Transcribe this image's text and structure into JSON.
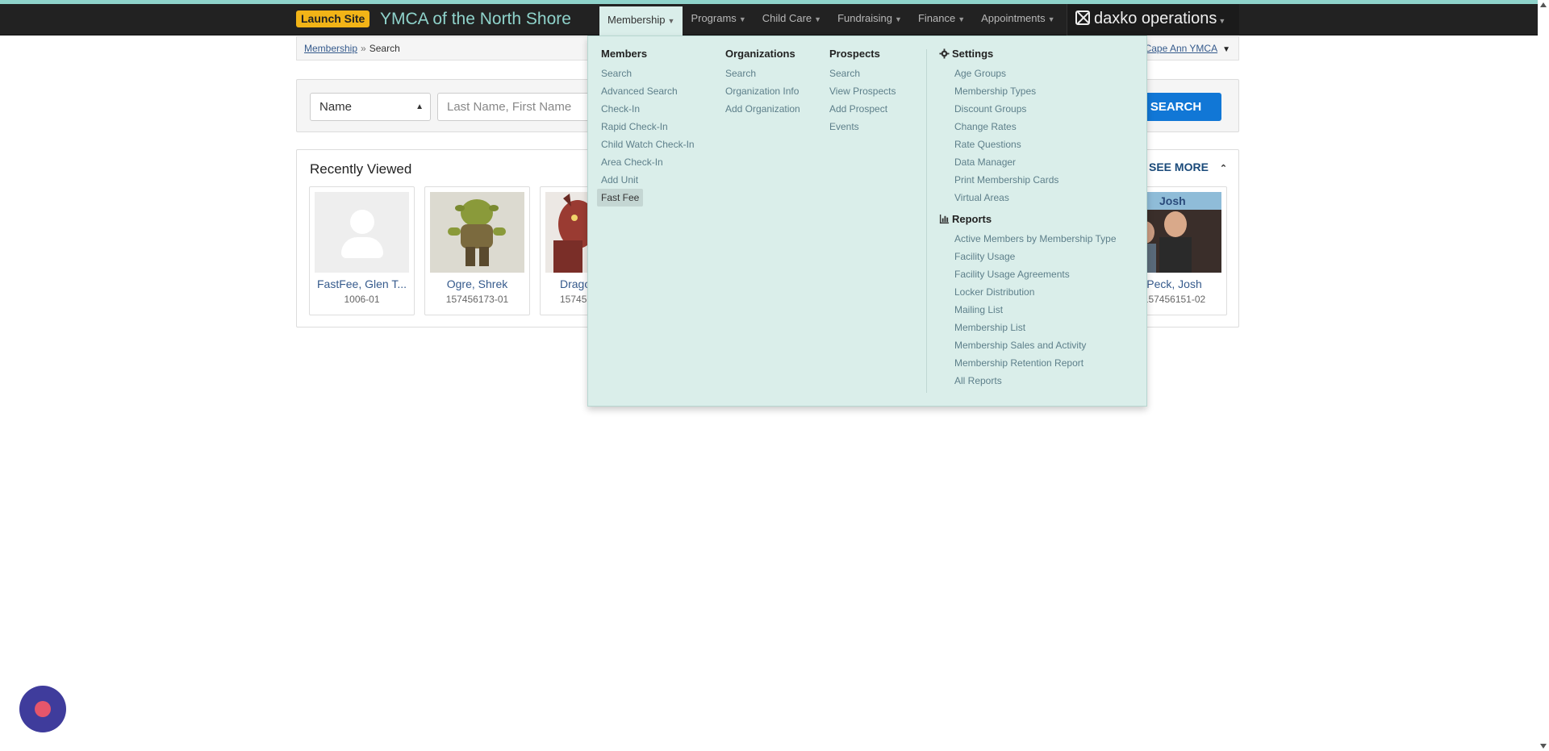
{
  "header": {
    "launch_label": "Launch Site",
    "brand": "YMCA of the North Shore",
    "menus": [
      {
        "label": "Membership"
      },
      {
        "label": "Programs"
      },
      {
        "label": "Child Care"
      },
      {
        "label": "Fundraising"
      },
      {
        "label": "Finance"
      },
      {
        "label": "Appointments"
      }
    ],
    "daxko_label": "daxko operations"
  },
  "breadcrumb": {
    "link": "Membership",
    "separator": "»",
    "current": "Search",
    "branch": "Cape Ann YMCA"
  },
  "search": {
    "type_selected": "Name",
    "placeholder": "Last Name, First Name",
    "button_label": "SEARCH"
  },
  "recent": {
    "title": "Recently Viewed",
    "see_more": "SEE MORE",
    "cards": [
      {
        "name": "FastFee, Glen T...",
        "number": "1006-01"
      },
      {
        "name": "Ogre, Shrek",
        "number": "157456173-01"
      },
      {
        "name": "Drago",
        "number": "15745"
      },
      {
        "name": "Peck, Josh",
        "number": "157456151-02"
      }
    ]
  },
  "dropdown": {
    "members": {
      "heading": "Members",
      "items": [
        "Search",
        "Advanced Search",
        "Check-In",
        "Rapid Check-In",
        "Child Watch Check-In",
        "Area Check-In",
        "Add Unit",
        "Fast Fee"
      ]
    },
    "organizations": {
      "heading": "Organizations",
      "items": [
        "Search",
        "Organization Info",
        "Add Organization"
      ]
    },
    "prospects": {
      "heading": "Prospects",
      "items": [
        "Search",
        "View Prospects",
        "Add Prospect",
        "Events"
      ]
    },
    "settings": {
      "heading": "Settings",
      "icon": "gear-icon",
      "items": [
        "Age Groups",
        "Membership Types",
        "Discount Groups",
        "Change Rates",
        "Rate Questions",
        "Data Manager",
        "Print Membership Cards",
        "Virtual Areas"
      ]
    },
    "reports": {
      "heading": "Reports",
      "icon": "bar-chart-icon",
      "items": [
        "Active Members by Membership Type",
        "Facility Usage",
        "Facility Usage Agreements",
        "Locker Distribution",
        "Mailing List",
        "Membership List",
        "Membership Sales and Activity",
        "Membership Retention Report",
        "All Reports"
      ]
    }
  },
  "colors": {
    "accent": "#1177d6",
    "navbar": "#222222",
    "dropdown_bg": "#daeeea",
    "launch": "#f2b417",
    "brand": "#8fd3cb"
  }
}
